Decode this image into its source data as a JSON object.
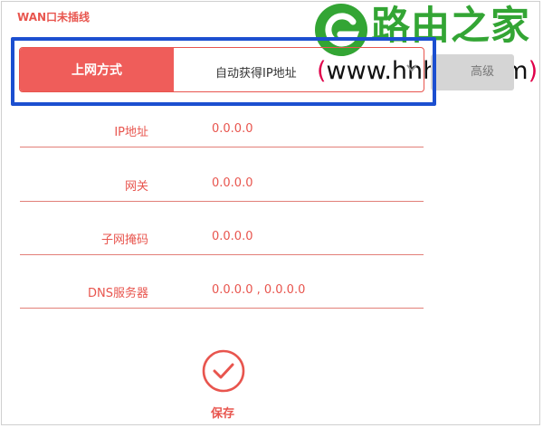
{
  "wan_status": "WAN口未插线",
  "watermark": {
    "title": "路由之家",
    "url_open": "(",
    "url_text": "www.hhhyh.com",
    "url_close": ")"
  },
  "connection": {
    "label": "上网方式",
    "value": "自动获得IP地址"
  },
  "ghost_tab_label": "高级",
  "fields": [
    {
      "label": "IP地址",
      "value": "0.0.0.0"
    },
    {
      "label": "网关",
      "value": "0.0.0.0"
    },
    {
      "label": "子网掩码",
      "value": "0.0.0.0"
    },
    {
      "label": "DNS服务器",
      "value": "0.0.0.0 , 0.0.0.0"
    }
  ],
  "save_label": "保存",
  "colors": {
    "accent": "#e8554e",
    "accent_fill": "#ef5d5a",
    "highlight": "#1c4fd0",
    "watermark_green": "#33a534"
  },
  "icons": [
    "chevron-down-icon",
    "save-check-icon",
    "watermark-logo-icon"
  ]
}
